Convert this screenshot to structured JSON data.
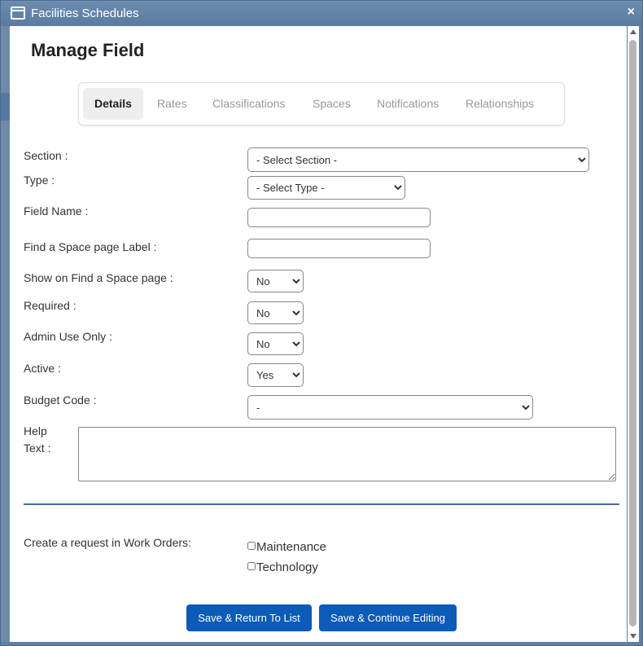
{
  "window": {
    "title": "Facilities Schedules",
    "close_label": "×"
  },
  "page": {
    "title": "Manage Field"
  },
  "tabs": [
    {
      "label": "Details",
      "active": true
    },
    {
      "label": "Rates",
      "active": false
    },
    {
      "label": "Classifications",
      "active": false
    },
    {
      "label": "Spaces",
      "active": false
    },
    {
      "label": "Notifications",
      "active": false
    },
    {
      "label": "Relationships",
      "active": false
    }
  ],
  "form": {
    "section": {
      "label": "Section :",
      "value": "- Select Section -"
    },
    "type": {
      "label": "Type :",
      "value": "- Select Type -"
    },
    "field_name": {
      "label": "Field Name :",
      "value": ""
    },
    "space_label": {
      "label": "Find a Space page Label :",
      "value": ""
    },
    "show_on_find": {
      "label": "Show on Find a Space page :",
      "value": "No"
    },
    "required": {
      "label": "Required :",
      "value": "No"
    },
    "admin_only": {
      "label": "Admin Use Only :",
      "value": "No"
    },
    "active": {
      "label": "Active :",
      "value": "Yes"
    },
    "budget_code": {
      "label": "Budget Code :",
      "value": "-"
    },
    "help_text": {
      "label_line1": "Help",
      "label_line2": "Text :",
      "value": ""
    }
  },
  "work_orders": {
    "label": "Create a request in Work Orders:",
    "options": [
      {
        "label": "Maintenance",
        "checked": false
      },
      {
        "label": "Technology",
        "checked": false
      }
    ]
  },
  "buttons": {
    "save_return": "Save & Return To List",
    "save_continue": "Save & Continue Editing"
  },
  "colors": {
    "titlebar": "#5f7fa3",
    "primary_button": "#0b5bb7",
    "divider": "#3b6ea8"
  }
}
